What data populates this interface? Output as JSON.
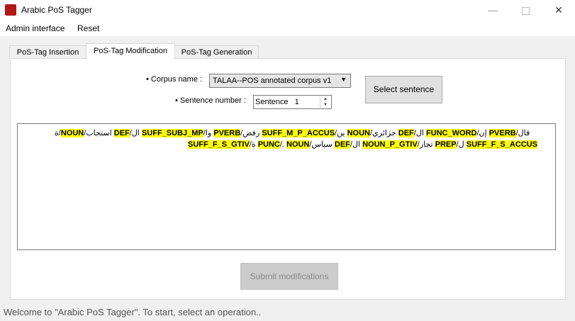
{
  "window": {
    "title": "Arabic PoS Tagger",
    "icon_name": "app-logo-icon",
    "icon_text": "Arabic PoS Tagger"
  },
  "menu": {
    "items": [
      {
        "label": "Admin interface"
      },
      {
        "label": "Reset"
      }
    ]
  },
  "tabs": [
    {
      "label": "PoS-Tag Insertion",
      "active": false
    },
    {
      "label": "PoS-Tag Modification",
      "active": true
    },
    {
      "label": "PoS-Tag Generation",
      "active": false
    }
  ],
  "form": {
    "corpus_label": "Corpus name :",
    "corpus_value": "TALAA--POS annotated corpus v1",
    "sentence_label": "Sentence number :",
    "sentence_prefix": "Sentence",
    "sentence_value": "1",
    "select_button": "Select sentence",
    "submit_button": "Submit modifications"
  },
  "tagged_sentence": {
    "line1": [
      {
        "text": "ة/",
        "tag": false
      },
      {
        "text": "NOUN",
        "tag": true
      },
      {
        "text": "/استجاب ",
        "tag": false
      },
      {
        "text": "DEF",
        "tag": true
      },
      {
        "text": "/ال ",
        "tag": false
      },
      {
        "text": "SUFF_SUBJ_MP",
        "tag": true
      },
      {
        "text": "/وا ",
        "tag": false
      },
      {
        "text": "PVERB",
        "tag": true
      },
      {
        "text": "/رفض ",
        "tag": false
      },
      {
        "text": "SUFF_M_P_ACCUS",
        "tag": true
      },
      {
        "text": "/ين ",
        "tag": false
      },
      {
        "text": "NOUN",
        "tag": true
      },
      {
        "text": "/جزائري ",
        "tag": false
      },
      {
        "text": "DEF",
        "tag": true
      },
      {
        "text": "/ال ",
        "tag": false
      },
      {
        "text": "FUNC_WORD",
        "tag": true
      },
      {
        "text": "/إن ",
        "tag": false
      },
      {
        "text": "PVERB",
        "tag": true
      },
      {
        "text": "/قال",
        "tag": false
      }
    ],
    "line2": [
      {
        "text": "SUFF_F_S_GTIV",
        "tag": true
      },
      {
        "text": "/ة ",
        "tag": false
      },
      {
        "text": "PUNC",
        "tag": true
      },
      {
        "text": "/. ",
        "tag": false
      },
      {
        "text": "NOUN",
        "tag": true
      },
      {
        "text": "/سياس ",
        "tag": false
      },
      {
        "text": "DEF",
        "tag": true
      },
      {
        "text": "/ال ",
        "tag": false
      },
      {
        "text": "NOUN_P_GTIV",
        "tag": true
      },
      {
        "text": "/تجار ",
        "tag": false
      },
      {
        "text": "PREP",
        "tag": true
      },
      {
        "text": "/ل ",
        "tag": false
      },
      {
        "text": "SUFF_F_S_ACCUS",
        "tag": true
      }
    ]
  },
  "status_bar": {
    "text": "Welcome to \"Arabic PoS Tagger\". To start, select an operation.."
  },
  "colors": {
    "tag_highlight": "#ffff00",
    "disabled_button": "#cccccc"
  }
}
